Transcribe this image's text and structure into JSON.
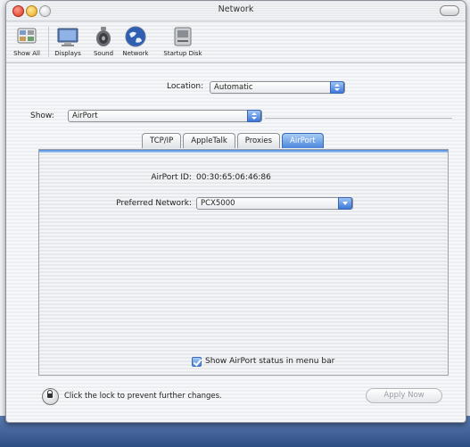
{
  "window": {
    "title": "Network"
  },
  "toolbar": {
    "items": [
      {
        "label": "Show All",
        "icon": "show-all-icon"
      },
      {
        "label": "Displays",
        "icon": "displays-icon"
      },
      {
        "label": "Sound",
        "icon": "sound-icon"
      },
      {
        "label": "Network",
        "icon": "network-icon"
      },
      {
        "label": "Startup Disk",
        "icon": "startup-disk-icon"
      }
    ]
  },
  "location": {
    "label": "Location:",
    "value": "Automatic"
  },
  "show": {
    "label": "Show:",
    "value": "AirPort"
  },
  "tabs": [
    {
      "label": "TCP/IP",
      "active": false
    },
    {
      "label": "AppleTalk",
      "active": false
    },
    {
      "label": "Proxies",
      "active": false
    },
    {
      "label": "AirPort",
      "active": true
    }
  ],
  "airport": {
    "id_label": "AirPort ID:",
    "id_value": "00:30:65:06:46:86",
    "preferred_label": "Preferred Network:",
    "preferred_value": "PCX5000",
    "status_checkbox_label": "Show AirPort status in menu bar",
    "status_checkbox_checked": true
  },
  "footer": {
    "lock_text": "Click the lock to prevent further changes.",
    "apply_label": "Apply Now"
  },
  "colors": {
    "accent": "#4a86db",
    "accent_light": "#a8ccf5"
  }
}
